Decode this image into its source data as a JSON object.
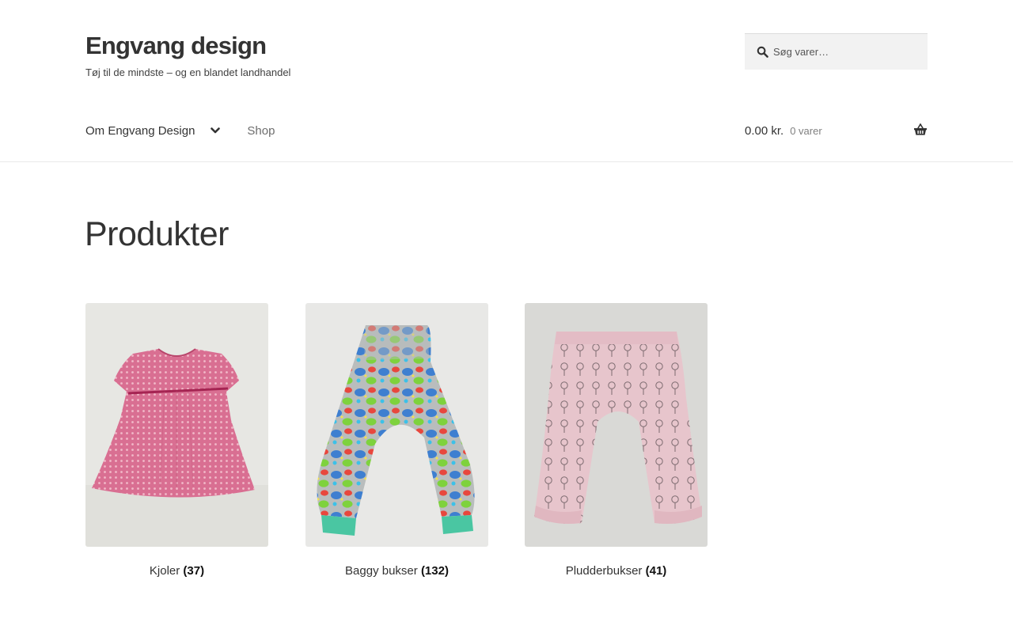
{
  "site": {
    "title": "Engvang design",
    "tagline": "Tøj til de mindste – og en blandet landhandel"
  },
  "search": {
    "placeholder": "Søg varer…"
  },
  "nav": {
    "items": [
      {
        "label": "Om Engvang Design",
        "has_dropdown": true
      },
      {
        "label": "Shop",
        "has_dropdown": false
      }
    ]
  },
  "cart": {
    "amount": "0.00 kr.",
    "count": "0 varer"
  },
  "page": {
    "title": "Produkter"
  },
  "products": [
    {
      "name": "Kjoler",
      "count": "(37)"
    },
    {
      "name": "Baggy bukser",
      "count": "(132)"
    },
    {
      "name": "Pludderbukser",
      "count": "(41)"
    }
  ],
  "colors": {
    "text": "#333333",
    "muted": "#6d6d6d",
    "search_bg": "#f2f2f2",
    "border": "#e9e9e9"
  }
}
